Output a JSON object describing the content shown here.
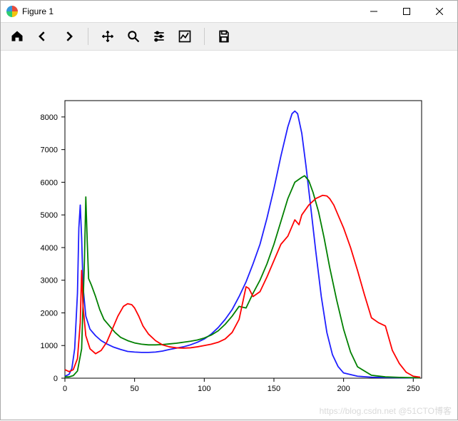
{
  "window": {
    "title": "Figure 1"
  },
  "toolbar": {
    "home": "Home",
    "back": "Back",
    "forward": "Forward",
    "pan": "Pan",
    "zoom": "Zoom",
    "configure": "Configure subplots",
    "edit": "Edit axis",
    "save": "Save"
  },
  "watermark": "https://blog.csdn.net @51CTO博客",
  "chart_data": {
    "type": "line",
    "xlabel": "",
    "ylabel": "",
    "xlim": [
      0,
      256
    ],
    "ylim": [
      0,
      8500
    ],
    "xticks": [
      0,
      50,
      100,
      150,
      200,
      250
    ],
    "yticks": [
      0,
      1000,
      2000,
      3000,
      4000,
      5000,
      6000,
      7000,
      8000
    ],
    "series": [
      {
        "name": "blue",
        "color": "#1f1fff",
        "x": [
          0,
          3,
          5,
          7,
          9,
          10,
          11,
          12,
          13,
          15,
          18,
          22,
          26,
          30,
          35,
          40,
          45,
          50,
          55,
          60,
          65,
          70,
          75,
          80,
          85,
          90,
          95,
          100,
          105,
          110,
          115,
          120,
          125,
          130,
          135,
          140,
          145,
          150,
          155,
          160,
          163,
          165,
          167,
          170,
          173,
          176,
          180,
          184,
          188,
          192,
          196,
          200,
          210,
          220,
          230,
          240,
          250,
          255
        ],
        "y": [
          60,
          120,
          300,
          900,
          2600,
          4600,
          5300,
          4300,
          2800,
          1900,
          1500,
          1300,
          1150,
          1050,
          950,
          880,
          820,
          800,
          790,
          790,
          800,
          830,
          880,
          920,
          960,
          1020,
          1100,
          1200,
          1350,
          1550,
          1800,
          2100,
          2500,
          2950,
          3500,
          4100,
          4900,
          5800,
          6800,
          7700,
          8100,
          8180,
          8100,
          7500,
          6500,
          5400,
          3900,
          2500,
          1400,
          720,
          360,
          160,
          60,
          30,
          20,
          15,
          10,
          10
        ]
      },
      {
        "name": "green",
        "color": "#008000",
        "x": [
          0,
          3,
          6,
          9,
          12,
          14,
          15,
          16,
          17,
          19,
          22,
          25,
          28,
          32,
          36,
          40,
          45,
          50,
          55,
          60,
          65,
          70,
          75,
          80,
          85,
          90,
          95,
          100,
          105,
          110,
          115,
          120,
          125,
          130,
          135,
          140,
          145,
          150,
          155,
          160,
          165,
          170,
          172,
          175,
          178,
          182,
          186,
          190,
          195,
          200,
          205,
          210,
          220,
          230,
          240,
          250,
          255
        ],
        "y": [
          40,
          40,
          80,
          220,
          900,
          3600,
          5550,
          4200,
          3050,
          2850,
          2500,
          2100,
          1800,
          1600,
          1400,
          1250,
          1150,
          1080,
          1040,
          1020,
          1020,
          1030,
          1050,
          1070,
          1100,
          1130,
          1170,
          1230,
          1320,
          1450,
          1650,
          1900,
          2200,
          2150,
          2600,
          3000,
          3500,
          4100,
          4800,
          5500,
          6000,
          6150,
          6200,
          6050,
          5700,
          5100,
          4300,
          3400,
          2400,
          1500,
          800,
          350,
          90,
          40,
          25,
          15,
          10
        ]
      },
      {
        "name": "red",
        "color": "#ff0000",
        "x": [
          0,
          3,
          6,
          9,
          11,
          12,
          13,
          15,
          18,
          22,
          26,
          30,
          34,
          38,
          42,
          45,
          48,
          50,
          53,
          56,
          60,
          65,
          70,
          75,
          80,
          85,
          90,
          95,
          100,
          105,
          110,
          115,
          120,
          125,
          128,
          130,
          132,
          135,
          140,
          145,
          150,
          155,
          160,
          165,
          168,
          170,
          175,
          180,
          185,
          188,
          190,
          193,
          196,
          200,
          205,
          210,
          215,
          220,
          225,
          230,
          235,
          240,
          245,
          250,
          255
        ],
        "y": [
          260,
          200,
          260,
          600,
          1700,
          3300,
          2200,
          1300,
          900,
          750,
          850,
          1100,
          1500,
          1900,
          2200,
          2280,
          2250,
          2150,
          1900,
          1600,
          1350,
          1150,
          1020,
          960,
          930,
          920,
          930,
          960,
          1000,
          1040,
          1100,
          1200,
          1400,
          1800,
          2400,
          2800,
          2750,
          2500,
          2650,
          3100,
          3600,
          4100,
          4350,
          4850,
          4700,
          5000,
          5300,
          5500,
          5600,
          5580,
          5500,
          5300,
          5000,
          4600,
          4000,
          3300,
          2550,
          1850,
          1700,
          1600,
          850,
          450,
          180,
          60,
          30
        ]
      }
    ]
  }
}
